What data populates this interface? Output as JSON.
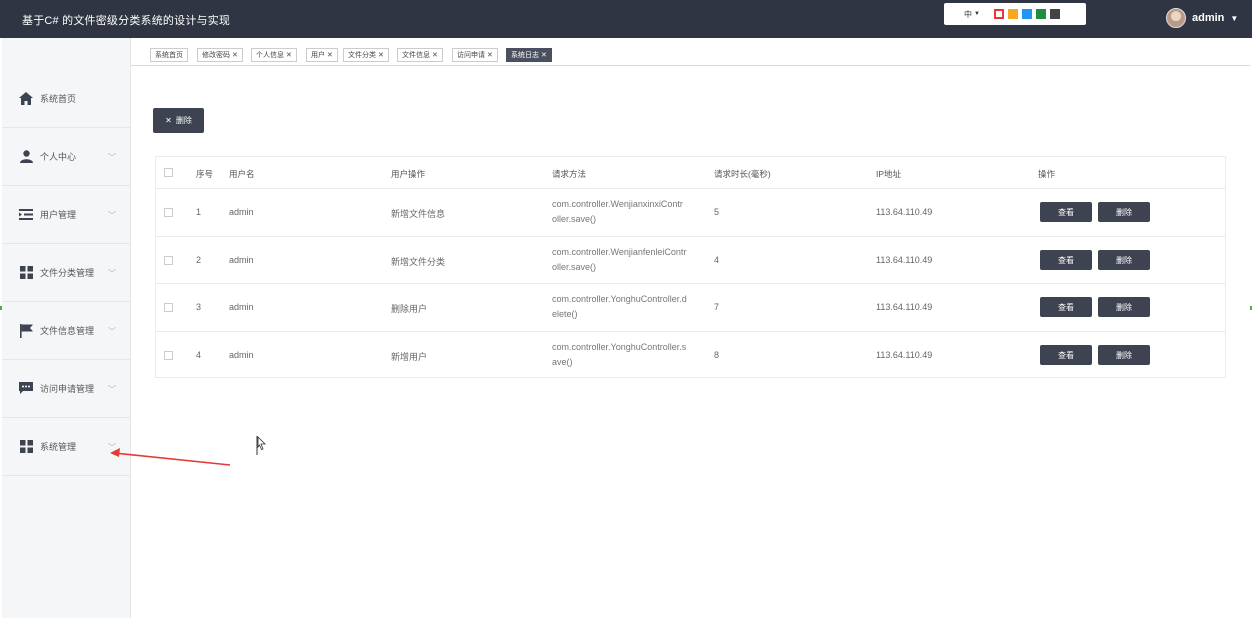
{
  "header": {
    "title": "基于C# 的文件密级分类系统的设计与实现",
    "lang": "中",
    "colors": [
      "#e53935",
      "#f5a623",
      "#2196f3",
      "#1e8e3e",
      "#444444"
    ],
    "user": "admin"
  },
  "sidebar": {
    "items": [
      {
        "label": "系统首页",
        "icon": "home-icon"
      },
      {
        "label": "个人中心",
        "icon": "user-icon"
      },
      {
        "label": "用户管理",
        "icon": "list-indent-icon"
      },
      {
        "label": "文件分类管理",
        "icon": "grid-icon"
      },
      {
        "label": "文件信息管理",
        "icon": "flag-icon"
      },
      {
        "label": "访问申请管理",
        "icon": "chat-icon"
      },
      {
        "label": "系统管理",
        "icon": "grid-icon"
      }
    ]
  },
  "tabs": [
    {
      "label": "系统首页"
    },
    {
      "label": "修改密码"
    },
    {
      "label": "个人信息"
    },
    {
      "label": "用户"
    },
    {
      "label": "文件分类"
    },
    {
      "label": "文件信息"
    },
    {
      "label": "访问申请"
    },
    {
      "label": "系统日志"
    }
  ],
  "toolbar": {
    "delete_label": "删除"
  },
  "table": {
    "columns": [
      "序号",
      "用户名",
      "用户操作",
      "请求方法",
      "请求时长(毫秒)",
      "IP地址",
      "操作"
    ],
    "rows": [
      {
        "no": "1",
        "user": "admin",
        "op": "新增文件信息",
        "method_1": "com.controller.WenjianxinxiContr",
        "method_2": "oller.save()",
        "time": "5",
        "ip": "113.64.110.49"
      },
      {
        "no": "2",
        "user": "admin",
        "op": "新增文件分类",
        "method_1": "com.controller.WenjianfenleiContr",
        "method_2": "oller.save()",
        "time": "4",
        "ip": "113.64.110.49"
      },
      {
        "no": "3",
        "user": "admin",
        "op": "删除用户",
        "method_1": "com.controller.YonghuController.d",
        "method_2": "elete()",
        "time": "7",
        "ip": "113.64.110.49"
      },
      {
        "no": "4",
        "user": "admin",
        "op": "新增用户",
        "method_1": "com.controller.YonghuController.s",
        "method_2": "ave()",
        "time": "8",
        "ip": "113.64.110.49"
      }
    ],
    "view_label": "查看",
    "delete_label": "删除"
  }
}
